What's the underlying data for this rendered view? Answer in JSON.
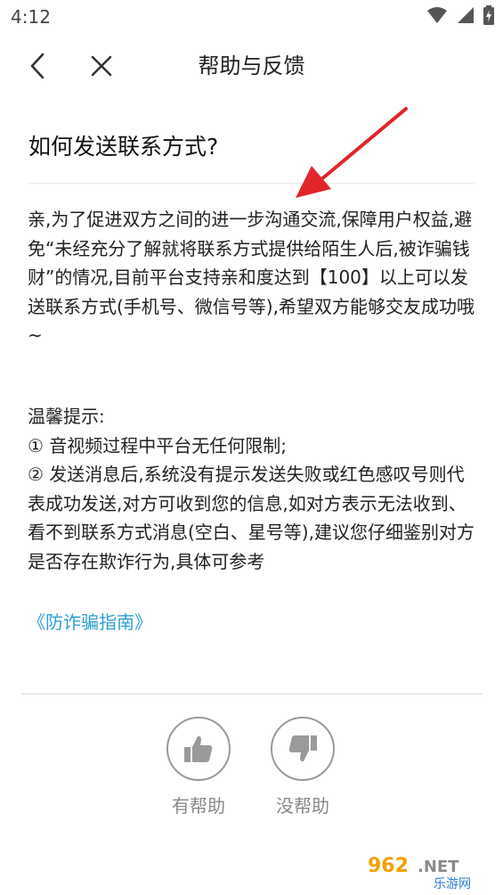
{
  "status_bar": {
    "time": "4:12"
  },
  "nav": {
    "title": "帮助与反馈"
  },
  "article": {
    "title": "如何发送联系方式?",
    "paragraph": "亲,为了促进双方之间的进一步沟通交流,保障用户权益,避免“未经充分了解就将联系方式提供给陌生人后,被诈骗钱财”的情况,目前平台支持亲和度达到【100】以上可以发送联系方式(手机号、微信号等),希望双方能够交友成功哦~",
    "tips_heading": "温馨提示:",
    "tips": [
      "① 音视频过程中平台无任何限制;",
      "② 发送消息后,系统没有提示发送失败或红色感叹号则代表成功发送,对方可收到您的信息,如对方表示无法收到、看不到联系方式消息(空白、星号等),建议您仔细鉴别对方是否存在欺诈行为,具体可参考"
    ],
    "link_text": "《防诈骗指南》"
  },
  "feedback": {
    "helpful_label": "有帮助",
    "not_helpful_label": "没帮助"
  },
  "watermark": {
    "brand": "962.NET",
    "sub": "乐游网"
  },
  "colors": {
    "link": "#2a9fd6",
    "annotation_arrow": "#e0262b",
    "icon_gray": "#9a9a9a"
  }
}
